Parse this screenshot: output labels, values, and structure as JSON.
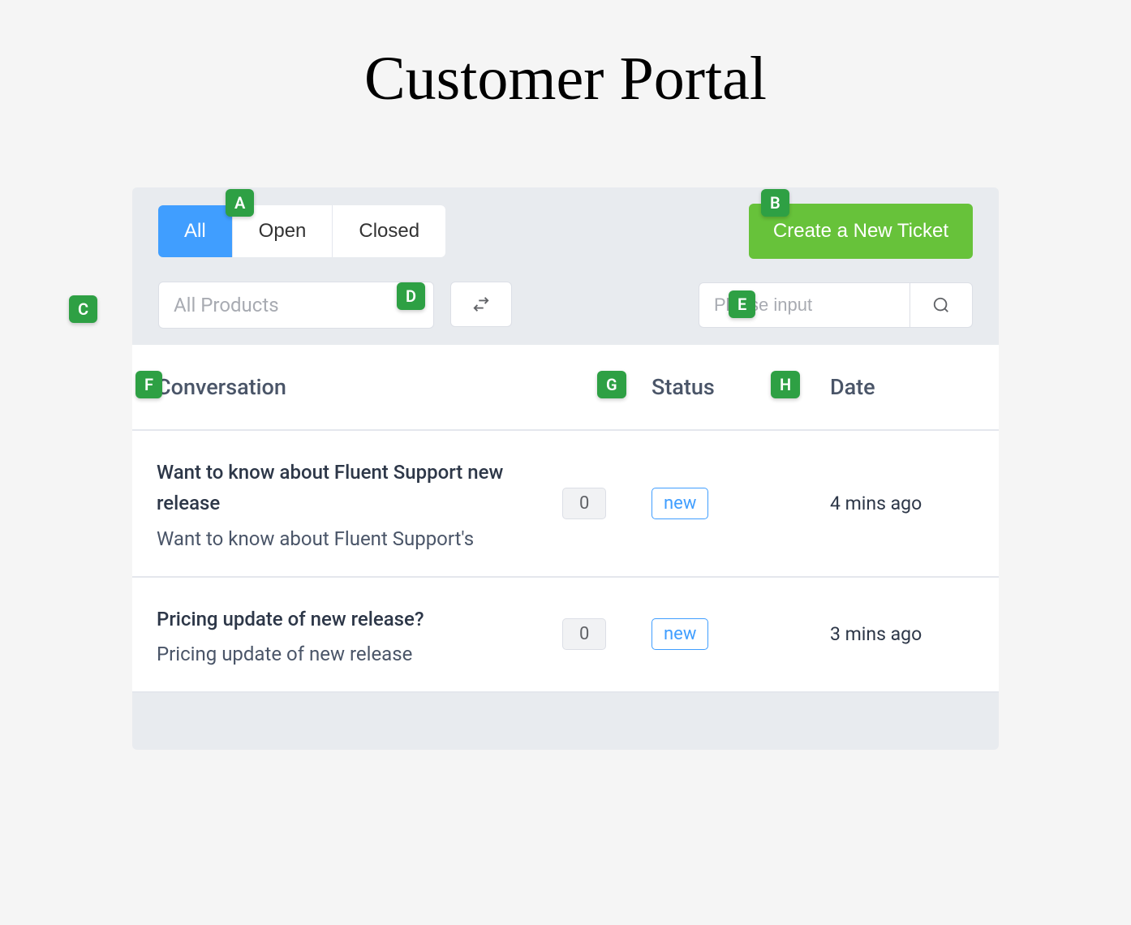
{
  "page": {
    "title": "Customer Portal"
  },
  "markers": {
    "A": "A",
    "B": "B",
    "C": "C",
    "D": "D",
    "E": "E",
    "F": "F",
    "G": "G",
    "H": "H"
  },
  "filter_tabs": {
    "all": "All",
    "open": "Open",
    "closed": "Closed"
  },
  "buttons": {
    "create_ticket": "Create a New Ticket"
  },
  "product_filter": {
    "selected": "All Products"
  },
  "search": {
    "placeholder": "Please input"
  },
  "table": {
    "headers": {
      "conversation": "Conversation",
      "status": "Status",
      "date": "Date"
    },
    "rows": [
      {
        "title": "Want to know about Fluent Support new release",
        "preview": "Want to know about Fluent Support's",
        "count": "0",
        "status": "new",
        "date": "4 mins ago"
      },
      {
        "title": "Pricing update of new release?",
        "preview": "Pricing update of new release",
        "count": "0",
        "status": "new",
        "date": "3 mins ago"
      }
    ]
  }
}
